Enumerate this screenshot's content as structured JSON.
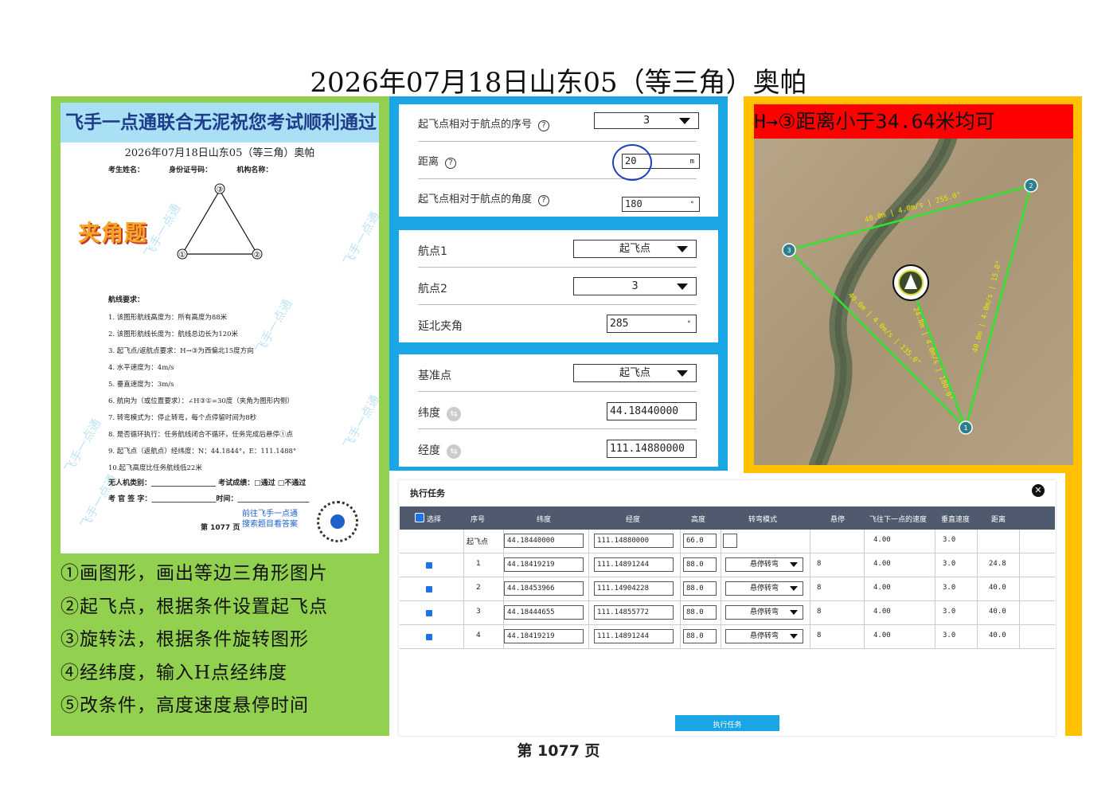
{
  "page_title": "2026年07月18日山东05（等三角）奥帕",
  "exam": {
    "banner": "飞手一点通联合无泥祝您考试顺利通过",
    "subtitle": "2026年07月18日山东05（等三角）奥帕",
    "fields": [
      "考生姓名：",
      "身份证号码：",
      "机构名称："
    ],
    "angle_tag": "夹角题",
    "triangle_labels": [
      "③",
      "①",
      "②"
    ],
    "req_title": "航线要求：",
    "requirements": [
      "1.  该图形航线高度为：所有高度为88米",
      "2.  该图形航线长度为：航线总边长为120米",
      "3.  起飞点/返航点要求：H→③为西偏北15度方向",
      "4.  水平速度为：4m/s",
      "5.  垂直速度为：3m/s",
      "6.  航向为（或位置要求）：∠H③①=30度（夹角为图形内侧）",
      "7.  转弯模式为：停止转弯，每个点停留时间为8秒",
      "8.  是否循环执行：任务航线闭合不循环，任务完成后悬停①点",
      "9.  起飞点（返航点）经纬度：N：44.1844°，E：111.1488°",
      "10.起飞高度比任务航线低22米"
    ],
    "sign_line1": "无人机类别：__________________    考试成绩：□通过   □不通过",
    "sign_line2": "考 官 签 字：__________________时间：____________________",
    "link": "前往飞手一点通\n搜索题目看答案",
    "page": "第  1077  页",
    "watermark": "飞手一点通"
  },
  "steps": [
    "①画图形，画出等边三角形图片",
    "②起飞点，根据条件设置起飞点",
    "③旋转法，根据条件旋转图形",
    "④经纬度，输入H点经纬度",
    "⑤改条件，高度速度悬停时间"
  ],
  "settings1": {
    "seq_label": "起飞点相对于航点的序号",
    "seq_value": "3",
    "dist_label": "距离",
    "dist_value": "20",
    "dist_unit": "m",
    "angle_label": "起飞点相对于航点的角度",
    "angle_value": "180",
    "angle_unit": "°"
  },
  "settings2": {
    "wp1_label": "航点1",
    "wp1_value": "起飞点",
    "wp2_label": "航点2",
    "wp2_value": "3",
    "north_label": "延北夹角",
    "north_value": "285",
    "north_unit": "°"
  },
  "settings3": {
    "base_label": "基准点",
    "base_value": "起飞点",
    "lat_label": "纬度",
    "lat_value": "44.18440000",
    "lon_label": "经度",
    "lon_value": "111.14880000"
  },
  "map": {
    "banner": "H→③距离小于34.64米均可",
    "edge_top": "40.0m | 4.0m/s | 255.0°",
    "edge_right": "40.0m | 4.0m/s | 15.0°",
    "edge_left": "40.0m | 4.0m/s | 135.0°",
    "edge_home": "24.8m | 4.0m/s | 180.0°",
    "wp_labels": [
      "1",
      "2",
      "3"
    ]
  },
  "task": {
    "title": "执行任务",
    "headers": [
      "选择",
      "序号",
      "纬度",
      "经度",
      "高度",
      "转弯模式",
      "悬停",
      "飞往下一点的速度",
      "垂直速度",
      "距离"
    ],
    "rows": [
      {
        "seq": "起飞点",
        "lat": "44.18440000",
        "lon": "111.14880000",
        "alt": "66.0",
        "turn": "",
        "hover": "",
        "speed": "4.00",
        "vspeed": "3.0",
        "dist": "",
        "check": false
      },
      {
        "seq": "1",
        "lat": "44.18419219",
        "lon": "111.14891244",
        "alt": "88.0",
        "turn": "悬停转弯",
        "hover": "8",
        "speed": "4.00",
        "vspeed": "3.0",
        "dist": "24.8",
        "check": true
      },
      {
        "seq": "2",
        "lat": "44.18453966",
        "lon": "111.14904228",
        "alt": "88.0",
        "turn": "悬停转弯",
        "hover": "8",
        "speed": "4.00",
        "vspeed": "3.0",
        "dist": "40.0",
        "check": true
      },
      {
        "seq": "3",
        "lat": "44.18444655",
        "lon": "111.14855772",
        "alt": "88.0",
        "turn": "悬停转弯",
        "hover": "8",
        "speed": "4.00",
        "vspeed": "3.0",
        "dist": "40.0",
        "check": true
      },
      {
        "seq": "4",
        "lat": "44.18419219",
        "lon": "111.14891244",
        "alt": "88.0",
        "turn": "悬停转弯",
        "hover": "8",
        "speed": "4.00",
        "vspeed": "3.0",
        "dist": "40.0",
        "check": true
      }
    ],
    "exec_label": "执行任务"
  },
  "footer": "第 1077 页",
  "colors": {
    "green_panel": "#92d050",
    "blue_panel": "#1aa6e6",
    "orange_panel": "#ffc000",
    "map_banner": "#ff0000",
    "path_green": "#2ee62e"
  }
}
